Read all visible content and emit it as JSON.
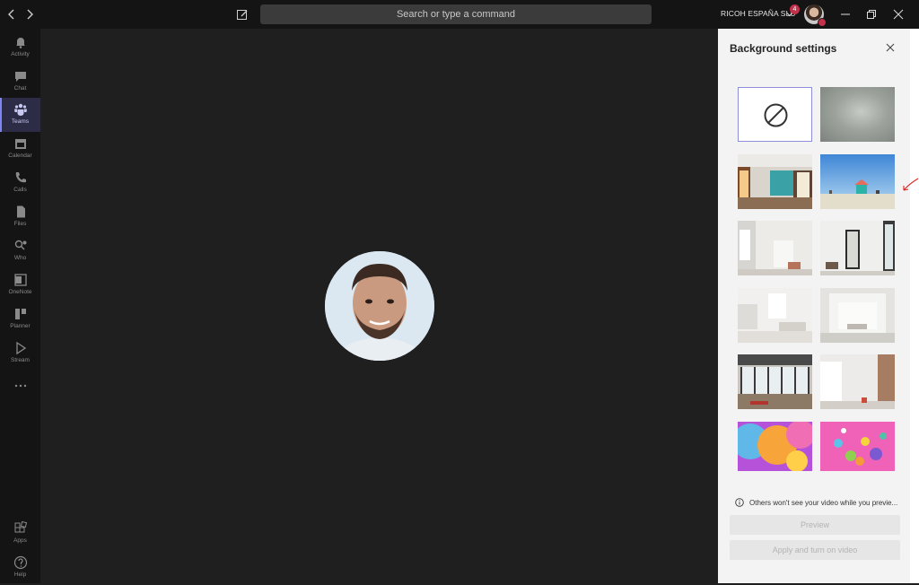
{
  "titlebar": {
    "search_placeholder": "Search or type a command",
    "org_name": "RICOH ESPAÑA SLU",
    "notification_count": "4"
  },
  "rail": {
    "items": [
      {
        "label": "Activity",
        "icon": "bell-icon"
      },
      {
        "label": "Chat",
        "icon": "chat-icon"
      },
      {
        "label": "Teams",
        "icon": "teams-icon",
        "active": true
      },
      {
        "label": "Calendar",
        "icon": "calendar-icon"
      },
      {
        "label": "Calls",
        "icon": "phone-icon"
      },
      {
        "label": "Files",
        "icon": "files-icon"
      },
      {
        "label": "Who",
        "icon": "who-icon"
      },
      {
        "label": "OneNote",
        "icon": "onenote-icon"
      },
      {
        "label": "Planner",
        "icon": "planner-icon"
      },
      {
        "label": "Stream",
        "icon": "stream-icon"
      },
      {
        "label": "Apps",
        "icon": "apps-icon"
      },
      {
        "label": "Help",
        "icon": "help-icon"
      }
    ]
  },
  "panel": {
    "title": "Background settings",
    "notice": "Others won't see your video while you previe...",
    "preview_label": "Preview",
    "apply_label": "Apply and turn on video",
    "backgrounds": [
      "none",
      "blur",
      "office-loft",
      "beach",
      "white-room",
      "white-loft-mirror",
      "white-studio",
      "white-arch",
      "industrial-office",
      "white-wall",
      "orange-balloons",
      "pink-balloons"
    ]
  },
  "colors": {
    "accent": "#7f85f5",
    "badge": "#c4314b"
  }
}
